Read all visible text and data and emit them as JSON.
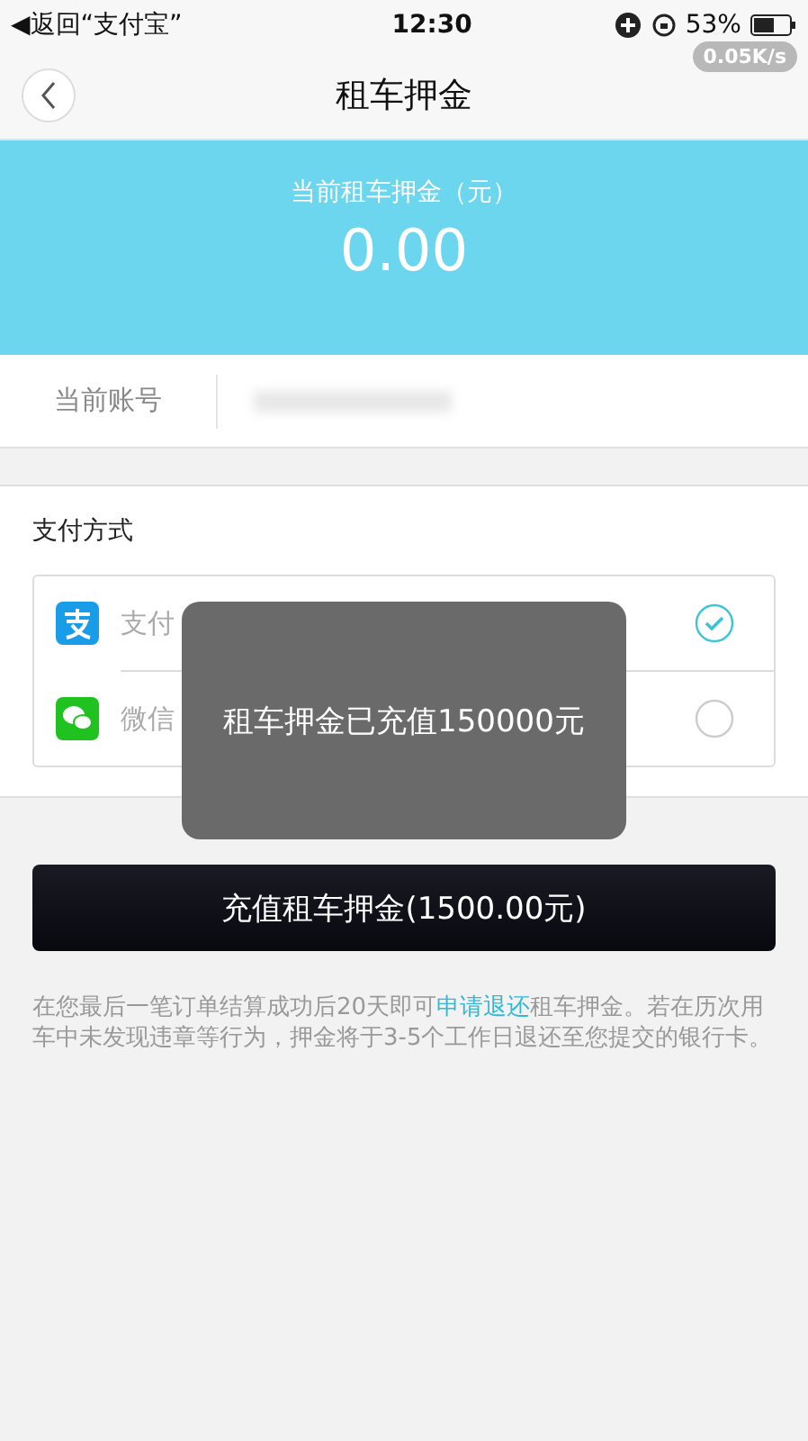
{
  "status_bar": {
    "back_app": "◀返回“支付宝”",
    "time": "12:30",
    "battery": "53%",
    "net_speed": "0.05K/s"
  },
  "nav": {
    "title": "租车押金"
  },
  "deposit": {
    "label": "当前租车押金（元）",
    "amount": "0.00"
  },
  "account": {
    "label": "当前账号"
  },
  "payment": {
    "title": "支付方式",
    "methods": [
      {
        "kind": "alipay",
        "label": "支付",
        "selected": true
      },
      {
        "kind": "wechat",
        "label": "微信",
        "selected": false
      }
    ]
  },
  "toast": "租车押金已充值150000元",
  "recharge_button": "充值租车押金(1500.00元)",
  "notice": {
    "before": "在您最后一笔订单结算成功后20天即可",
    "link": "申请退还",
    "after": "租车押金。若在历次用车中未发现违章等行为，押金将于3-5个工作日退还至您提交的银行卡。"
  }
}
